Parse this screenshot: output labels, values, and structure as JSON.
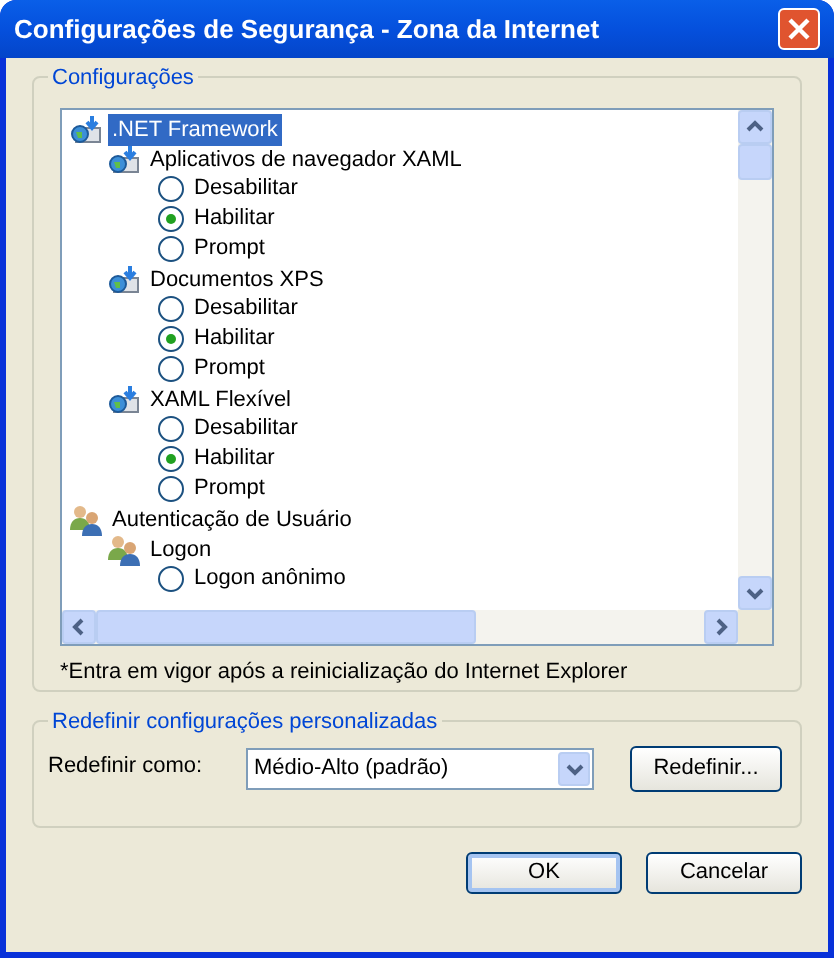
{
  "window": {
    "title": "Configurações de Segurança - Zona da Internet"
  },
  "settings_group": {
    "title": "Configurações",
    "note": "*Entra em vigor após a reinicialização do Internet Explorer"
  },
  "tree": [
    {
      "kind": "framework",
      "label": ".NET Framework",
      "selected": true,
      "children": [
        {
          "kind": "framework",
          "label": "Aplicativos de navegador XAML",
          "selected": false,
          "children": [
            {
              "kind": "radio",
              "label": "Desabilitar",
              "checked": false
            },
            {
              "kind": "radio",
              "label": "Habilitar",
              "checked": true
            },
            {
              "kind": "radio",
              "label": "Prompt",
              "checked": false
            }
          ]
        },
        {
          "kind": "framework",
          "label": "Documentos XPS",
          "selected": false,
          "children": [
            {
              "kind": "radio",
              "label": "Desabilitar",
              "checked": false
            },
            {
              "kind": "radio",
              "label": "Habilitar",
              "checked": true
            },
            {
              "kind": "radio",
              "label": "Prompt",
              "checked": false
            }
          ]
        },
        {
          "kind": "framework",
          "label": "XAML Flexível",
          "selected": false,
          "children": [
            {
              "kind": "radio",
              "label": "Desabilitar",
              "checked": false
            },
            {
              "kind": "radio",
              "label": "Habilitar",
              "checked": true
            },
            {
              "kind": "radio",
              "label": "Prompt",
              "checked": false
            }
          ]
        }
      ]
    },
    {
      "kind": "users",
      "label": "Autenticação de Usuário",
      "selected": false,
      "children": [
        {
          "kind": "users",
          "label": "Logon",
          "selected": false,
          "children": [
            {
              "kind": "radio",
              "label": "Logon anônimo",
              "checked": false
            }
          ]
        }
      ]
    }
  ],
  "reset_group": {
    "title": "Redefinir configurações personalizadas",
    "label": "Redefinir como:",
    "value": "Médio-Alto (padrão)",
    "button": "Redefinir..."
  },
  "buttons": [
    "OK",
    "Cancelar"
  ]
}
